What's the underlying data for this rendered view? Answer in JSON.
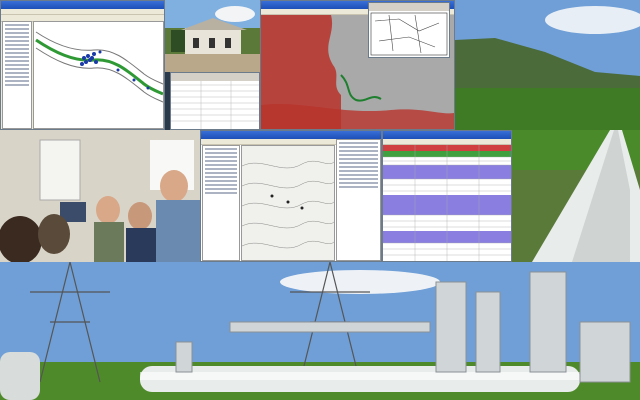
{
  "collage": {
    "tiles": [
      {
        "name": "gis-desktop-map-app"
      },
      {
        "name": "site-building-photo"
      },
      {
        "name": "terrain-map-app"
      },
      {
        "name": "hill-landscape-photo"
      },
      {
        "name": "office-team-photo"
      },
      {
        "name": "topographic-map-app"
      },
      {
        "name": "data-table-app"
      },
      {
        "name": "pipeline-field-photo"
      },
      {
        "name": "pipeline-station-photo"
      }
    ]
  },
  "colors": {
    "sky": "#6f9fd6",
    "grass": "#4f8a2a",
    "pipe": "#e8ecea",
    "table_highlight": "#8a7fe0",
    "terrain_red": "#b8332a"
  }
}
